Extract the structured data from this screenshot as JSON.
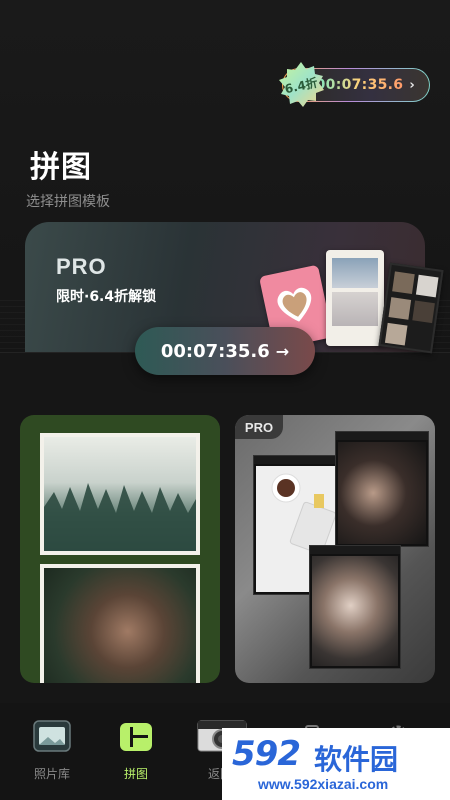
{
  "promo": {
    "discount_badge": "6.4折",
    "timer_top": "00:07:35.6",
    "timer_main": "00:07:35.6",
    "arrow_top": "›",
    "arrow_main": "→"
  },
  "header": {
    "title": "拼图",
    "subtitle": "选择拼图模板"
  },
  "banner": {
    "pro_label": "PRO",
    "description": "限时·6.4折解锁"
  },
  "templates": [
    {
      "pro_badge": null
    },
    {
      "pro_badge": "PRO"
    }
  ],
  "nav": {
    "items": [
      {
        "label": "照片库",
        "icon": "photo-library-icon",
        "active": false
      },
      {
        "label": "拼图",
        "icon": "collage-icon",
        "active": true
      },
      {
        "label": "返回",
        "icon": "camera-icon",
        "active": false
      },
      {
        "label": "",
        "icon": "camera-outline-icon",
        "active": false
      },
      {
        "label": "",
        "icon": "gear-icon",
        "active": false
      }
    ]
  },
  "watermark": {
    "logo": "592",
    "name": "软件园",
    "url": "www.592xiazai.com"
  },
  "colors": {
    "accent": "#b8f06a",
    "background": "#141414",
    "watermark_blue": "#2a66d8"
  }
}
